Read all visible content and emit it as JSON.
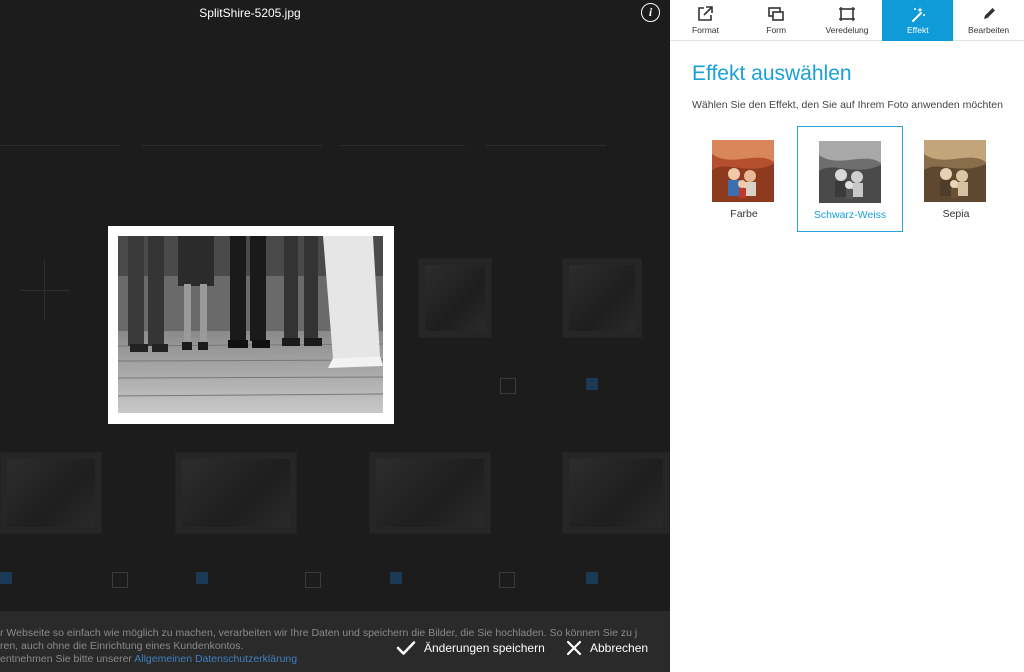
{
  "editor": {
    "filename": "SplitShire-5205.jpg",
    "info_icon": "info-icon"
  },
  "actions": {
    "save_label": "Änderungen speichern",
    "save_icon": "checkmark-icon",
    "cancel_label": "Abbrechen",
    "cancel_icon": "close-icon"
  },
  "cookie_notice": {
    "line1": "r Webseite so einfach wie möglich zu machen, verarbeiten wir Ihre Daten und speichern die Bilder, die Sie hochladen. So können Sie zu j",
    "line2": "ren, auch ohne die Einrichtung eines Kundenkontos.",
    "line3_prefix": "entnehmen Sie bitte unserer ",
    "line3_link": "Allgemeinen Datenschutzerklärung"
  },
  "panel": {
    "tabs": [
      {
        "label": "Format",
        "icon": "external-link-icon",
        "active": false
      },
      {
        "label": "Form",
        "icon": "shapes-icon",
        "active": false
      },
      {
        "label": "Veredelung",
        "icon": "frame-icon",
        "active": false
      },
      {
        "label": "Effekt",
        "icon": "magic-wand-icon",
        "active": true
      },
      {
        "label": "Bearbeiten",
        "icon": "pencil-icon",
        "active": false
      }
    ],
    "title": "Effekt auswählen",
    "subtitle": "Wählen Sie den Effekt, den Sie auf Ihrem Foto anwenden möchten",
    "effects": [
      {
        "label": "Farbe",
        "selected": false
      },
      {
        "label": "Schwarz-Weiss",
        "selected": true
      },
      {
        "label": "Sepia",
        "selected": false
      }
    ]
  },
  "colors": {
    "accent": "#0f9bd7",
    "panel_bg": "#ffffff",
    "overlay_bg": "#141414"
  }
}
